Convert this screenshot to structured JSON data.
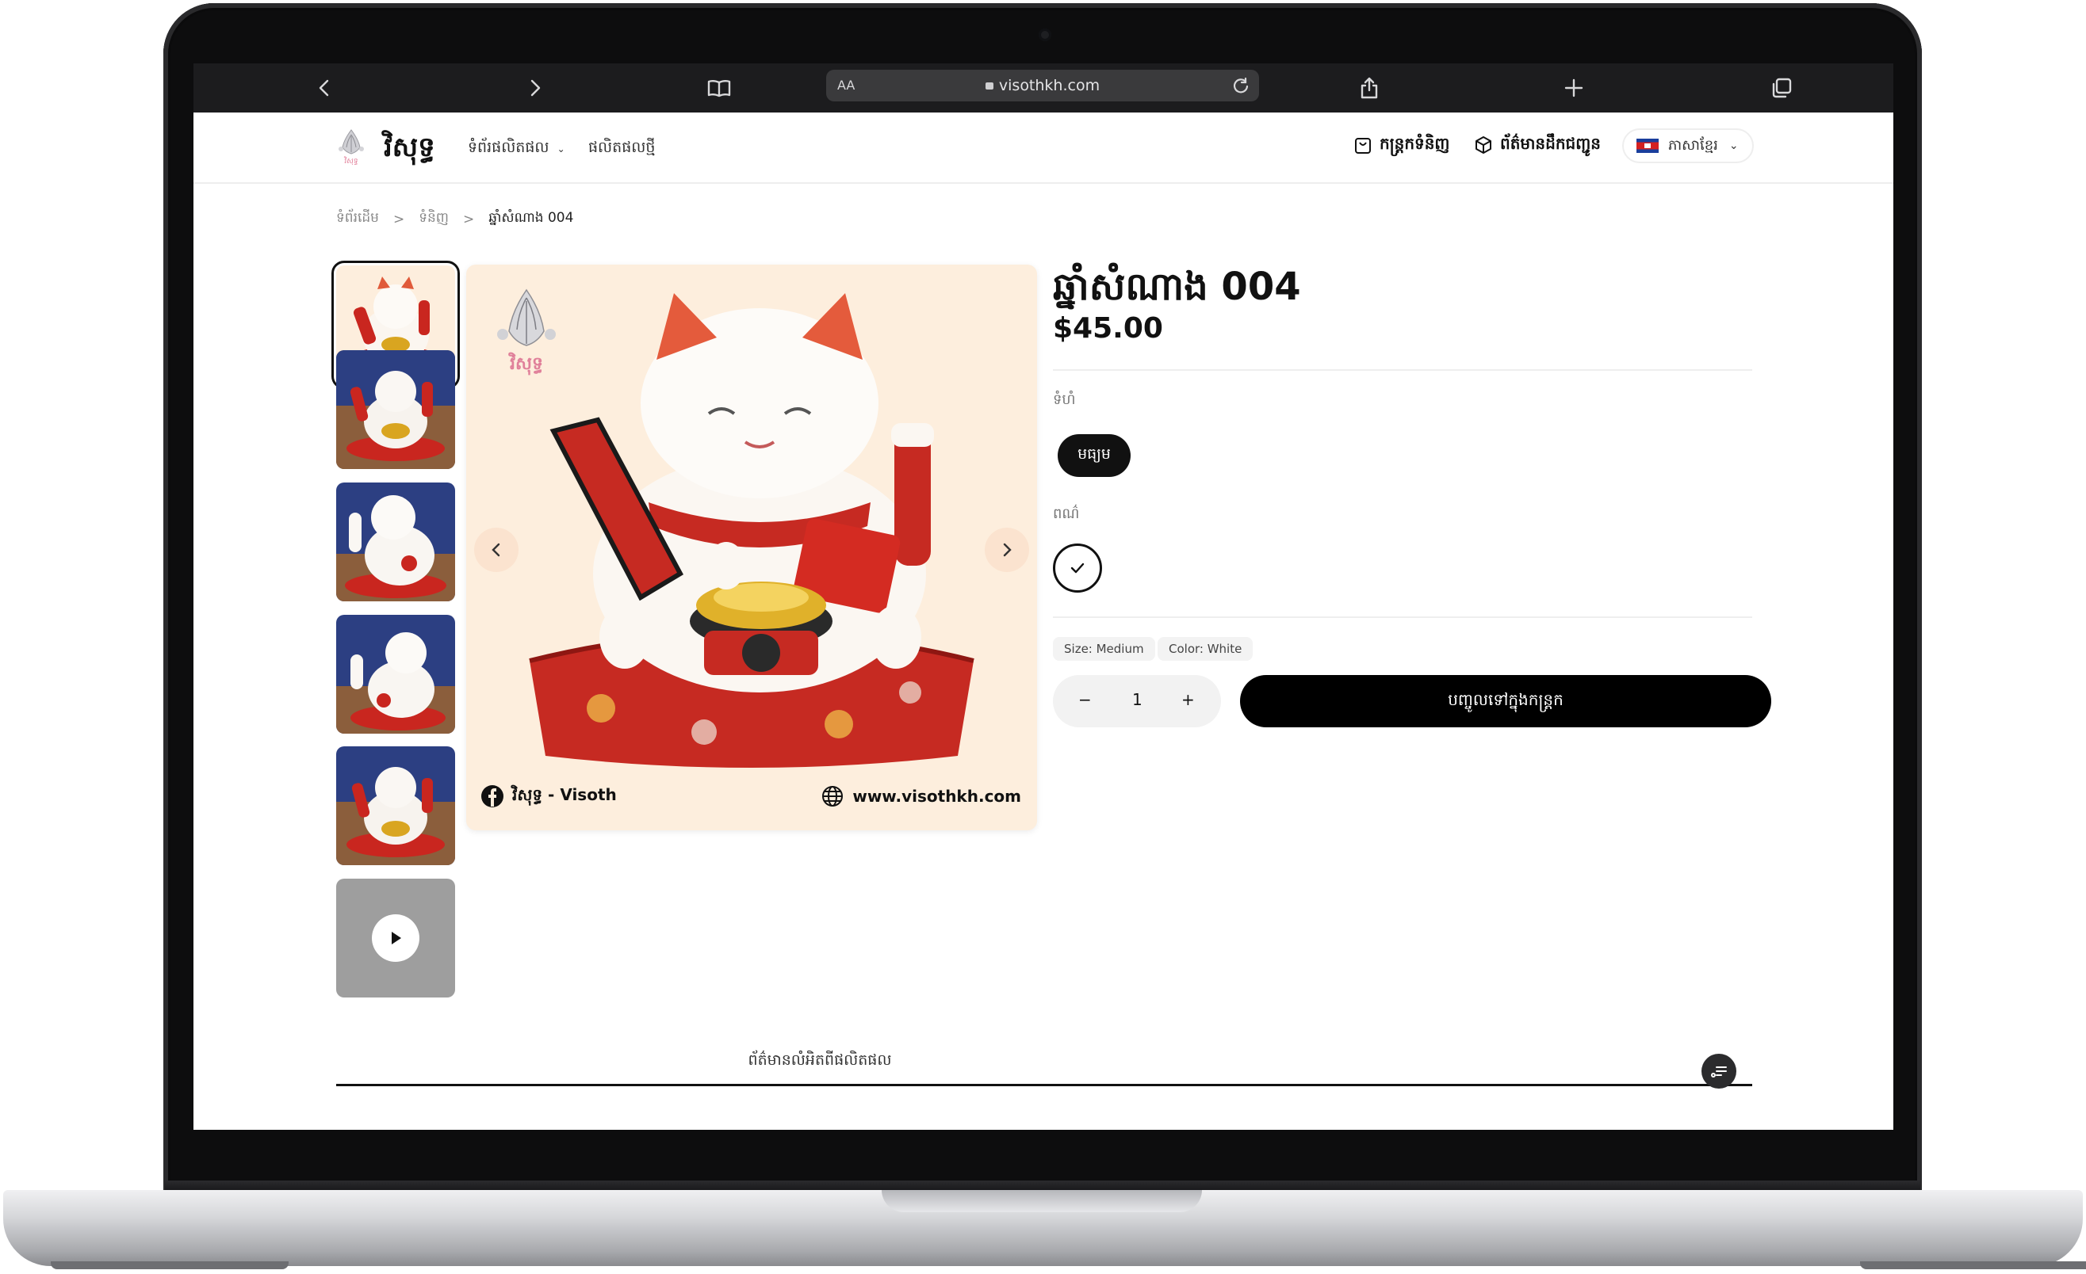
{
  "browser": {
    "aa_label": "AA",
    "url": "visothkh.com"
  },
  "site": {
    "brand": "វិសុទ្ធ",
    "nav_links": [
      "ទំព័រផលិតផល",
      "ផលិតផលថ្មី"
    ],
    "cart_label": "កន្ត្រកទំនិញ",
    "shipping_label": "ព័ត៌មានដឹកជញ្ជូន",
    "language_label": "ភាសាខ្មែរ"
  },
  "breadcrumb": {
    "items": [
      "ទំព័រដើម",
      "ទំនិញ",
      "ឆ្នាំសំណាង 004"
    ],
    "separator": ">"
  },
  "product": {
    "title": "ឆ្នាំសំណាង 004",
    "price": "$45.00",
    "size_label": "ទំហំ",
    "size_option": "មធ្យម",
    "color_label": "ពណ៌",
    "selected_tags": [
      "Size: Medium",
      "Color: White"
    ],
    "quantity": "1",
    "add_to_cart": "បញ្ចូលទៅក្នុងកន្ត្រក",
    "thumbnail_count": 6
  },
  "image_overlay": {
    "fb_text": "វិសុទ្ធ - Visoth",
    "web_text": "www.visothkh.com"
  },
  "tabs": {
    "details_label": "ព័ត៌មានលំអិតពីផលិតផល"
  },
  "colors": {
    "accent": "#000000",
    "image_bg": "#fdeedd"
  }
}
